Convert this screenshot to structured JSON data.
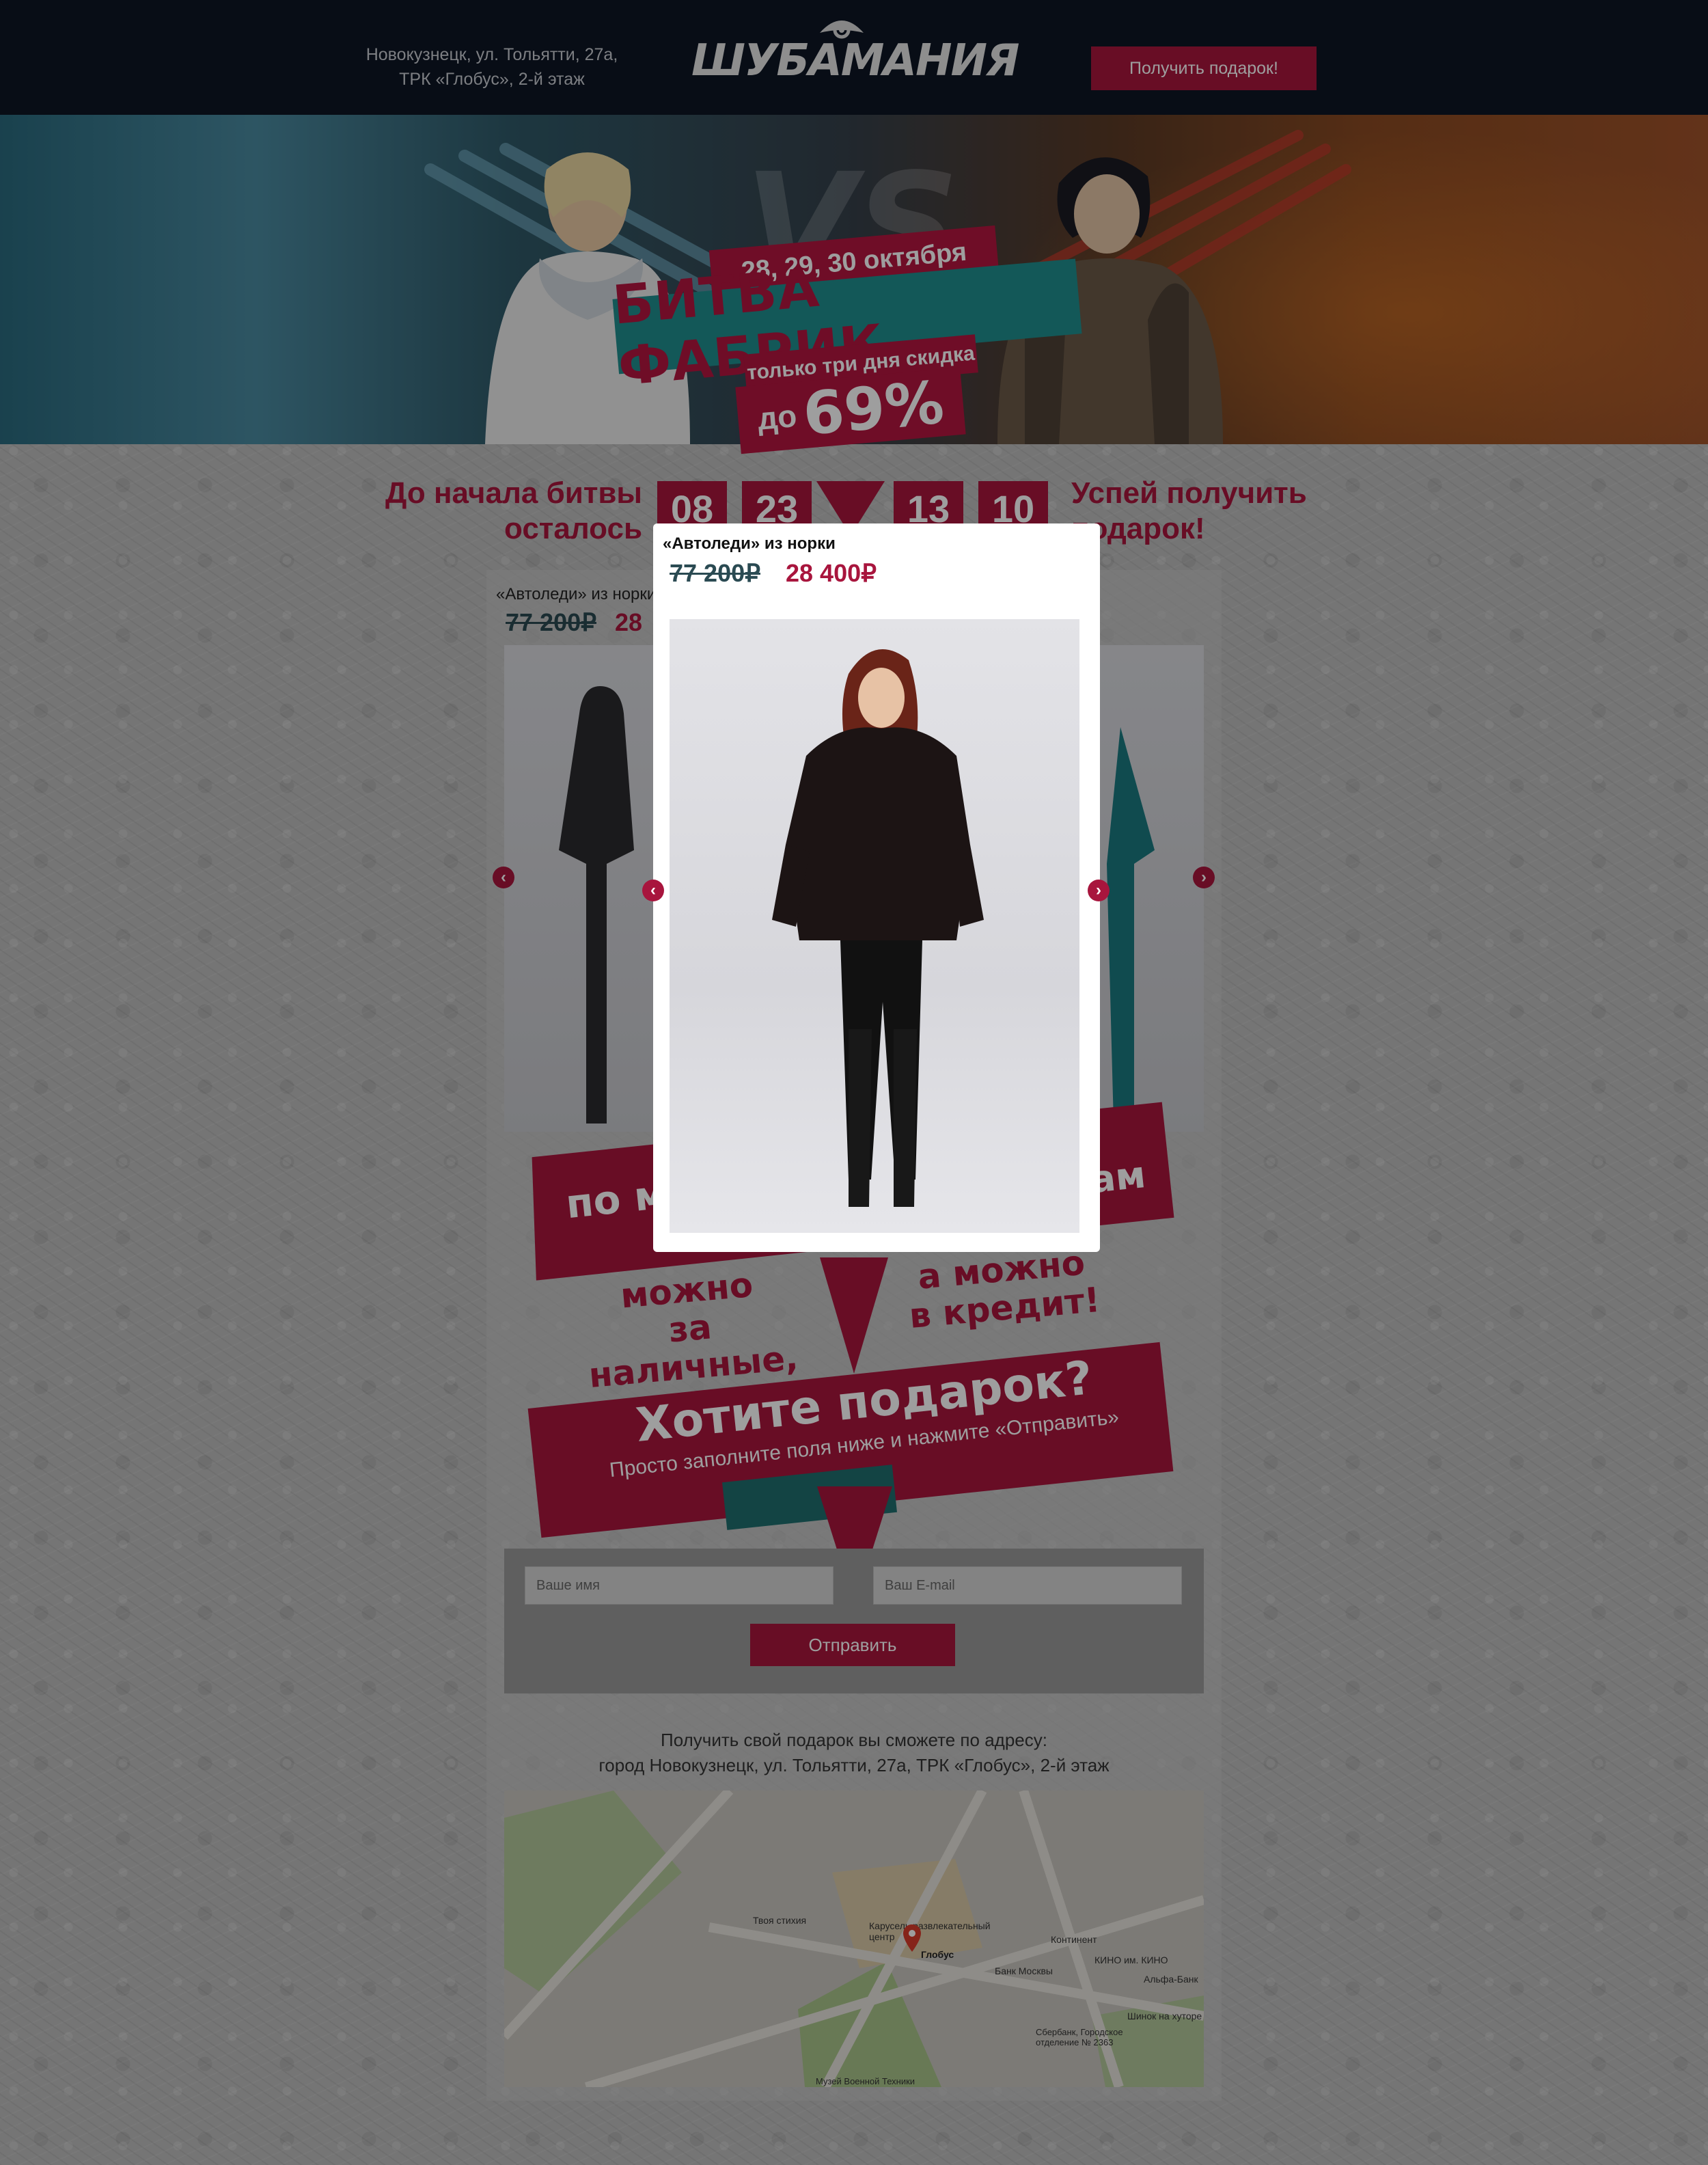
{
  "header": {
    "address_line1": "Новокузнецк, ул. Тольятти, 27а,",
    "address_line2": "ТРК «Глобус», 2-й этаж",
    "logo_text": "ШУБАМАНИЯ",
    "gift_button": "Получить подарок!"
  },
  "hero": {
    "dates": "28, 29, 30 октября",
    "title": "БИТВА ФАБРИК",
    "subtitle": "только три дня скидка",
    "discount_prefix": "до",
    "discount_value": "69%",
    "vs": "VS"
  },
  "countdown": {
    "left_label_line1": "До начала битвы",
    "left_label_line2": "осталось",
    "values": [
      "08",
      "23",
      "13",
      "10"
    ],
    "right_label_line1": "Успей получить",
    "right_label_line2": "подарок!"
  },
  "card": {
    "title": "«Автоледи» из норки",
    "old_price": "77 200₽",
    "new_price": "28"
  },
  "promo": {
    "band_left": "по м",
    "band_right": "ам",
    "cash_line1": "можно",
    "cash_line2": "за наличные,",
    "credit_line1": "а можно",
    "credit_line2": "в кредит!"
  },
  "gift": {
    "title": "Хотите подарок?",
    "subtitle": "Просто заполните поля ниже и нажмите «Отправить»"
  },
  "form": {
    "name_placeholder": "Ваше имя",
    "email_placeholder": "Ваш E-mail",
    "submit_label": "Отправить"
  },
  "pickup": {
    "line1": "Получить свой подарок вы сможете по адресу:",
    "line2": "город Новокузнецк, ул. Тольятти, 27а, ТРК «Глобус», 2-й этаж"
  },
  "map": {
    "labels": [
      "Твоя стихия",
      "Карусель развлекательный центр",
      "Глобус",
      "Континент",
      "КИНО им. КИНО",
      "Банк Москвы",
      "Альфа-Банк",
      "Шинок на хуторе",
      "Сбербанк, Городское отделение № 2363",
      "Музей Военной Техники"
    ]
  },
  "modal": {
    "title": "«Автоледи» из норки",
    "old_price": "77 200₽",
    "new_price": "28 400₽"
  },
  "colors": {
    "accent": "#a8153d",
    "header_bg": "#0d1524",
    "teal": "#1f8f8f"
  },
  "icons": [
    "chevron-left-icon",
    "chevron-right-icon",
    "map-pin-icon",
    "logo-eye-icon"
  ]
}
